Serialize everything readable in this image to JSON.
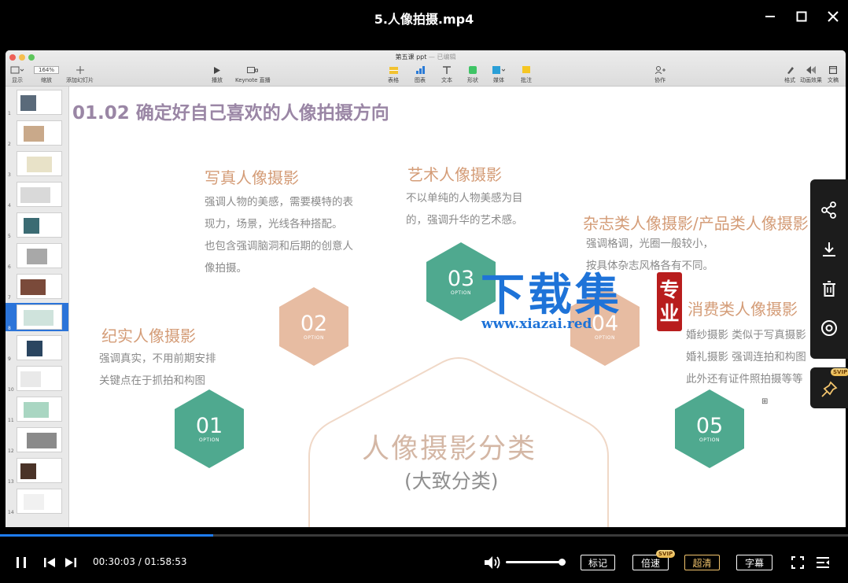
{
  "player": {
    "title": "5.人像拍摄.mp4",
    "current_time": "00:30:03",
    "separator": " / ",
    "duration": "01:58:53",
    "progress_fraction": 0.251,
    "volume_fraction": 0.93,
    "buttons": {
      "mark": "标记",
      "speed": "倍速",
      "quality": "超清",
      "subtitles": "字幕",
      "svip": "SVIP"
    },
    "colors": {
      "accent": "#1e7cf2",
      "quality_active": "#f2c46d"
    }
  },
  "keynote": {
    "doc_title": "第五课 ppt",
    "doc_status": "— 已编辑",
    "zoom": "164%",
    "toolbar_left": [
      {
        "label": "显示",
        "icon": "view-icon"
      },
      {
        "label": "缩放",
        "icon": "zoom-icon"
      },
      {
        "label": "添加幻灯片",
        "icon": "plus-icon"
      }
    ],
    "toolbar_play": [
      {
        "label": "播放",
        "icon": "play-icon"
      },
      {
        "label": "Keynote 直播",
        "icon": "live-icon"
      }
    ],
    "toolbar_insert": [
      {
        "label": "表格",
        "icon": "table-icon"
      },
      {
        "label": "图表",
        "icon": "chart-icon"
      },
      {
        "label": "文本",
        "icon": "text-icon"
      },
      {
        "label": "形状",
        "icon": "shape-icon"
      },
      {
        "label": "媒体",
        "icon": "media-icon"
      },
      {
        "label": "批注",
        "icon": "comment-icon"
      }
    ],
    "toolbar_collab": {
      "label": "协作",
      "icon": "collab-icon"
    },
    "toolbar_right": [
      {
        "label": "格式",
        "icon": "format-icon"
      },
      {
        "label": "动画效果",
        "icon": "animate-icon"
      },
      {
        "label": "文稿",
        "icon": "document-icon"
      }
    ],
    "slides": [
      "1",
      "2",
      "3",
      "4",
      "5",
      "6",
      "7",
      "8",
      "9",
      "10",
      "11",
      "12",
      "13",
      "14"
    ],
    "selected_slide": 8
  },
  "slide": {
    "title": "01.02 确定好自己喜欢的人像拍摄方向",
    "option_label": "OPTION",
    "center_title": "人像摄影分类",
    "center_sub": "(大致分类)",
    "move_mark": "⊞",
    "categories": [
      {
        "num": "01",
        "title": "纪实人像摄影",
        "lines": [
          "强调真实，不用前期安排",
          "关键点在于抓拍和构图"
        ]
      },
      {
        "num": "02",
        "title": "写真人像摄影",
        "lines": [
          "强调人物的美感，需要模特的表",
          "现力，场景，光线各种搭配。",
          "也包含强调脑洞和后期的创意人",
          "像拍摄。"
        ]
      },
      {
        "num": "03",
        "title": "艺术人像摄影",
        "lines": [
          "不以单纯的人物美感为目",
          "的，强调升华的艺术感。"
        ]
      },
      {
        "num": "04",
        "title": "杂志类人像摄影/产品类人像摄影",
        "lines": [
          "强调格调，光圈一般较小，",
          "按具体杂志风格各有不同。"
        ]
      },
      {
        "num": "05",
        "title": "消费类人像摄影",
        "lines": [
          "婚纱摄影 类似于写真摄影",
          "婚礼摄影 强调连拍和构图",
          "此外还有证件照拍摄等等"
        ]
      }
    ],
    "colors": {
      "teal": "#4fa98f",
      "peach": "#e7bca2",
      "title": "#9a86a5",
      "category_title": "#d49c77"
    }
  },
  "watermark": {
    "big": "下载集",
    "seal_chars": [
      "专",
      "业"
    ],
    "url": "www.xiazai.red"
  },
  "float_panel": [
    "share-icon",
    "download-icon",
    "trash-icon",
    "target-icon",
    "pin-icon"
  ]
}
